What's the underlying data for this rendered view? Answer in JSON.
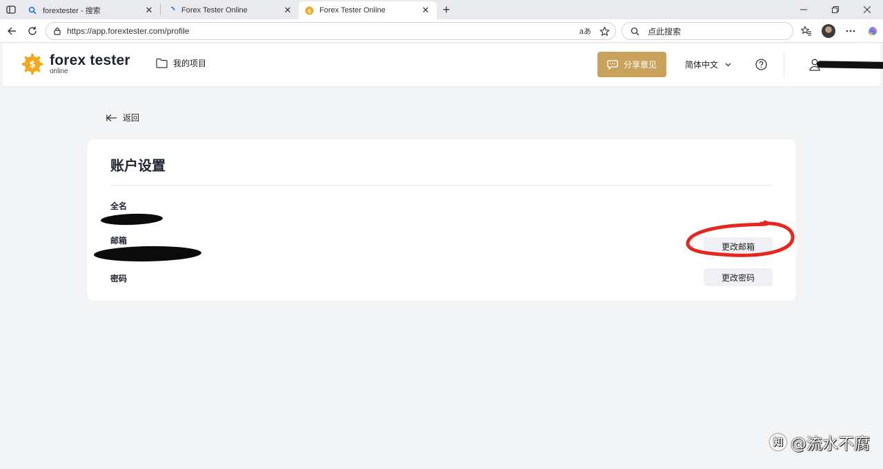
{
  "browser": {
    "tabs": [
      {
        "title": "forextester - 搜索",
        "icon": "search-favicon",
        "active": false
      },
      {
        "title": "Forex Tester Online",
        "icon": "loading-favicon",
        "active": false
      },
      {
        "title": "Forex Tester Online",
        "icon": "forextester-favicon",
        "active": true
      }
    ],
    "url": "https://app.forextester.com/profile",
    "search_placeholder": "点此搜索",
    "read_aloud_label": "aあ"
  },
  "header": {
    "logo_title": "forex tester",
    "logo_sub": "online",
    "my_projects": "我的项目",
    "feedback_button": "分享意见",
    "language": "简体中文",
    "brand_color": "#c8a25a"
  },
  "page": {
    "back_label": "返回",
    "card_title": "账户设置",
    "fields": {
      "full_name_label": "全名",
      "email_label": "邮箱",
      "password_label": "密码"
    },
    "change_email_button": "更改邮箱",
    "change_password_button": "更改密码"
  },
  "watermark": {
    "logo_letter": "知",
    "text": "@流水不腐"
  }
}
